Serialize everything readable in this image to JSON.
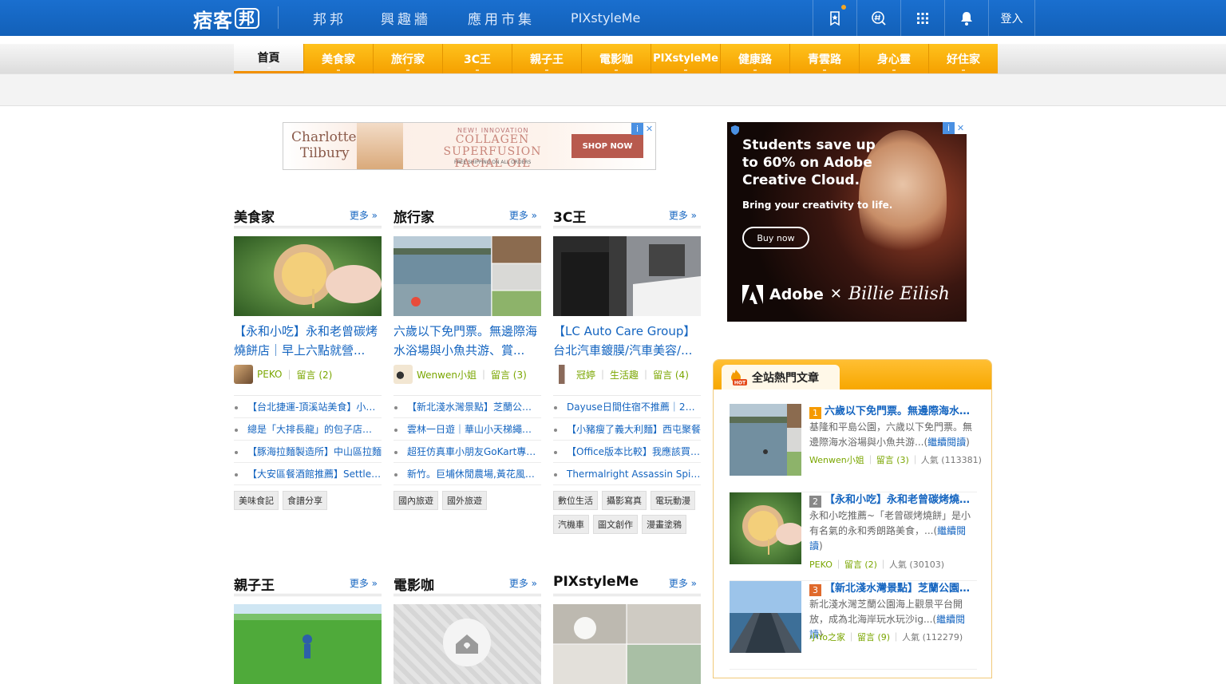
{
  "topbar": {
    "logo": "痞客",
    "logo_badge": "邦",
    "nav": [
      "邦邦",
      "興趣牆",
      "應用市集",
      "PIXstyleMe"
    ],
    "login": "登入",
    "colors": {
      "bar": "#1565c0",
      "notify_dot": "#f5a623"
    },
    "icons": [
      "bookmark-star-icon",
      "hashtag-search-icon",
      "apps-grid-icon",
      "bell-icon"
    ]
  },
  "categories": [
    "首頁",
    "美食家",
    "旅行家",
    "3C王",
    "親子王",
    "電影咖",
    "PIXstyleMe",
    "健康路",
    "青雲路",
    "身心靈",
    "好住家"
  ],
  "ad_banner": {
    "brand_line1": "Charlotte",
    "brand_line2": "Tilbury",
    "kicker": "NEW! INNOVATION",
    "headline1": "COLLAGEN SUPERFUSION",
    "headline2": "FACIAL OIL",
    "fine": "FREE SHIPPING ON ALL ORDERS",
    "cta": "SHOP NOW"
  },
  "ad_side": {
    "line1": "Students save up",
    "line2": "to 60% on Adobe",
    "line3": "Creative Cloud.",
    "sub": "Bring your creativity to life.",
    "cta": "Buy now",
    "brand": "Adobe",
    "x": "✕",
    "artist": "Billie Eilish"
  },
  "columns": [
    {
      "title": "美食家",
      "more": "更多 »",
      "post_title": "【永和小吃】永和老曾碳烤燒餅店｜早上六點就營...",
      "author": "PEKO",
      "comments": "留言 (2)",
      "section": "",
      "links": [
        "【台北捷運-頂溪站美食】小品牌甜點",
        "總是「大排長龍」的包子店！排隊",
        "【豚海拉麵製造所】中山區拉麵",
        "【大安區餐酒館推薦】Settle Bistro"
      ],
      "tags": [
        "美味食記",
        "食譜分享"
      ]
    },
    {
      "title": "旅行家",
      "more": "更多 »",
      "post_title": "六歲以下免門票。無邊際海水浴場與小魚共游、賞...",
      "author": "Wenwen小姐",
      "comments": "留言 (3)",
      "section": "",
      "links": [
        "【新北淺水灣景點】芝蘭公園海上觀景平台",
        "雲林一日遊｜華山小天梯繩索吊橋",
        "超狂仿真車小朋友GoKart專屬賽道",
        "新竹。巨埔休閒農場,黃花風鈴木"
      ],
      "tags": [
        "國內旅遊",
        "國外旅遊"
      ]
    },
    {
      "title": "3C王",
      "more": "更多 »",
      "post_title": "【LC Auto Care Group】台北汽車鍍膜/汽車美容/...",
      "author": "冠婷",
      "comments": "留言 (4)",
      "section": "生活趣",
      "links": [
        "Dayuse日間住宿不推薦｜2024",
        "【小豬瘦了義大利麵】西屯聚餐",
        "【Office版本比較】我應該買哪個",
        "Thermalright Assassin Spirit 120"
      ],
      "tags": [
        "數位生活",
        "攝影寫真",
        "電玩動漫",
        "汽機車",
        "圖文創作",
        "漫畫塗鴉"
      ]
    }
  ],
  "columns2": [
    {
      "title": "親子王",
      "more": "更多 »"
    },
    {
      "title": "電影咖",
      "more": "更多 »"
    },
    {
      "title": "PIXstyleMe",
      "more": "更多 »"
    }
  ],
  "hot": {
    "title": "全站熱門文章",
    "items": [
      {
        "rank": "1",
        "title": "六歲以下免門票。無邊際海水浴場",
        "desc": "基隆和平島公園，六歲以下免門票。無邊際海水浴場與小魚共游...",
        "more": "繼續閱讀",
        "author": "Wenwen小姐",
        "comments": "留言 (3)",
        "popularity": "人氣 (113381)",
        "rank_color": "#f59a00"
      },
      {
        "rank": "2",
        "title": "【永和小吃】永和老曾碳烤燒餅店",
        "desc": "永和小吃推薦~「老曾碳烤燒餅」是小有名氣的永和秀朗路美食，...",
        "more": "繼續閱讀",
        "author": "PEKO",
        "comments": "留言 (2)",
        "popularity": "人氣 (30103)",
        "rank_color": "#888888"
      },
      {
        "rank": "3",
        "title": "【新北淺水灣景點】芝蘭公園海上觀景",
        "desc": "新北淺水灣芝蘭公園海上觀景平台開放，成為北海岸玩水玩沙ig...",
        "more": "繼續閱讀",
        "author": "小Yo之家",
        "comments": "留言 (9)",
        "popularity": "人氣 (112279)",
        "rank_color": "#e06a2c"
      }
    ]
  }
}
